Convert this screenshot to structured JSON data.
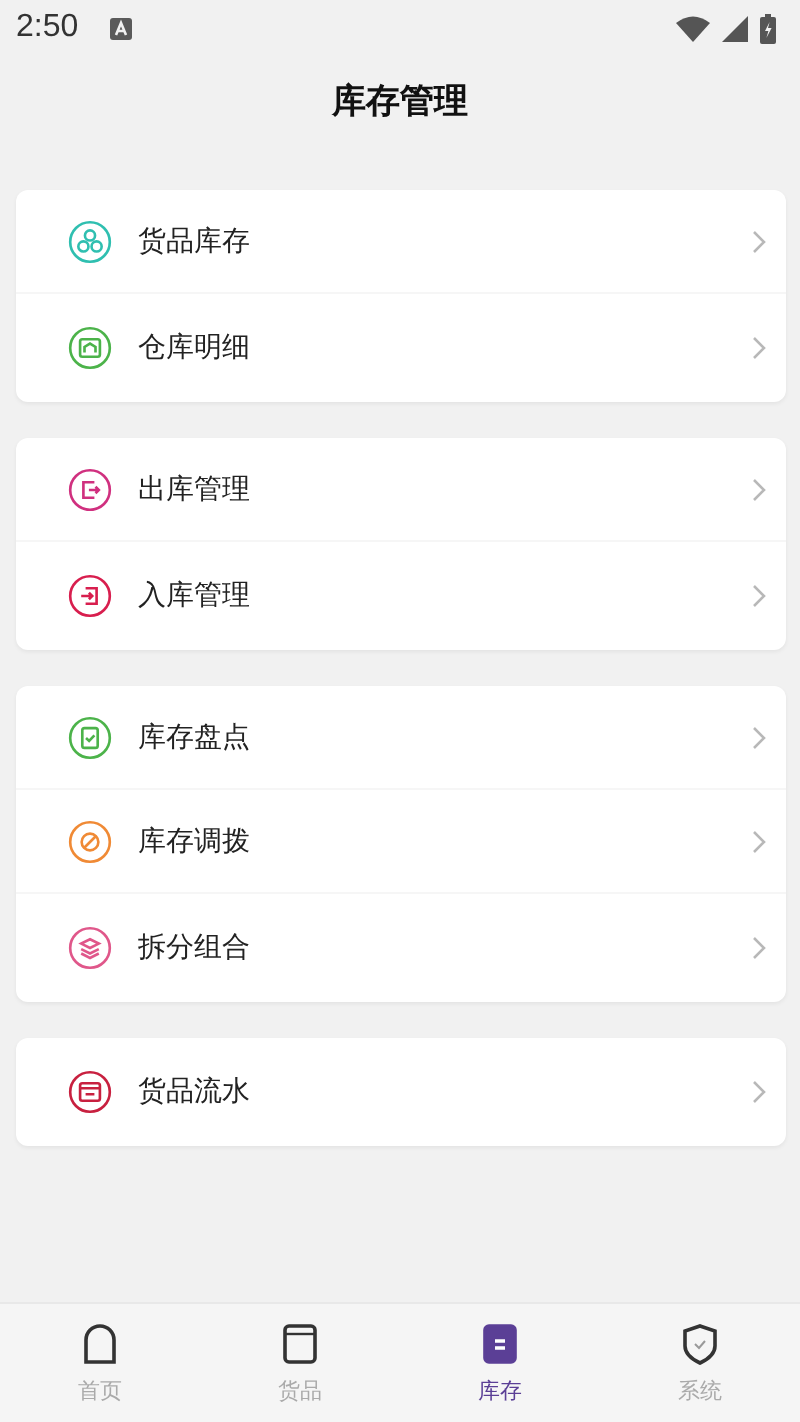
{
  "status_bar": {
    "time": "2:50"
  },
  "header": {
    "title": "库存管理"
  },
  "groups": [
    {
      "items": [
        {
          "label": "货品库存",
          "kind": "stock",
          "color": "#2fbfb0"
        },
        {
          "label": "仓库明细",
          "kind": "warehouse",
          "color": "#4cb34a"
        }
      ]
    },
    {
      "items": [
        {
          "label": "出库管理",
          "kind": "outbound",
          "color": "#d0307f"
        },
        {
          "label": "入库管理",
          "kind": "inbound",
          "color": "#d81e4e"
        }
      ]
    },
    {
      "items": [
        {
          "label": "库存盘点",
          "kind": "count",
          "color": "#4cb34a"
        },
        {
          "label": "库存调拨",
          "kind": "transfer",
          "color": "#f08a35"
        },
        {
          "label": "拆分组合",
          "kind": "split",
          "color": "#e0578a"
        }
      ]
    },
    {
      "items": [
        {
          "label": "货品流水",
          "kind": "flow",
          "color": "#c8203f"
        }
      ]
    }
  ],
  "tab_bar": [
    {
      "label": "首页",
      "kind": "home",
      "selected": false
    },
    {
      "label": "货品",
      "kind": "goods",
      "selected": false
    },
    {
      "label": "库存",
      "kind": "stock",
      "selected": true
    },
    {
      "label": "系统",
      "kind": "system",
      "selected": false
    }
  ]
}
